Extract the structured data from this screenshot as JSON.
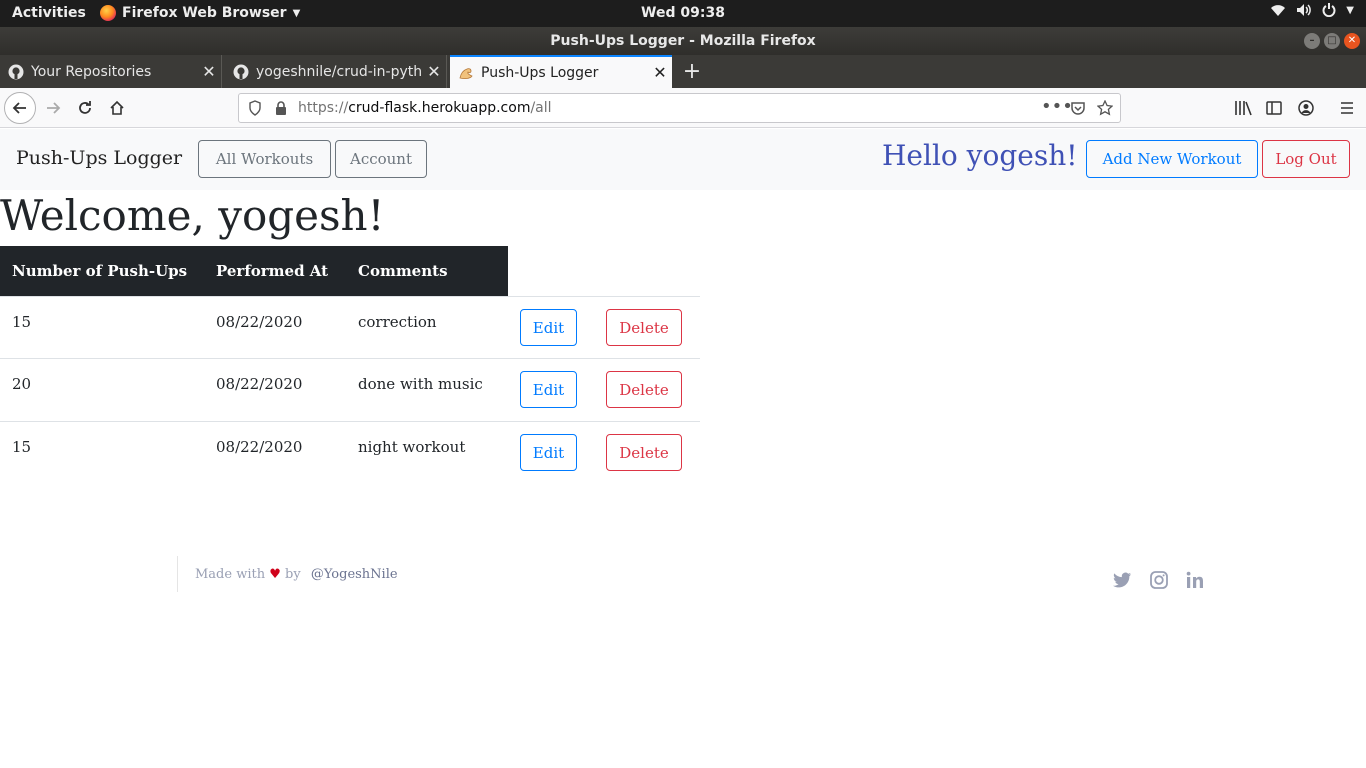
{
  "system": {
    "activities": "Activities",
    "app_menu": "Firefox Web Browser",
    "clock": "Wed 09:38"
  },
  "window": {
    "title": "Push-Ups Logger - Mozilla Firefox"
  },
  "tabs": [
    {
      "label": "Your Repositories",
      "icon": "github-icon"
    },
    {
      "label": "yogeshnile/crud-in-pytho",
      "icon": "github-icon"
    },
    {
      "label": "Push-Ups Logger",
      "icon": "flex-arm-icon",
      "active": true
    }
  ],
  "urlbar": {
    "scheme": "https://",
    "host": "crud-flask.herokuapp.com",
    "path": "/all"
  },
  "site_nav": {
    "brand": "Push-Ups Logger",
    "all_workouts": "All Workouts",
    "account": "Account",
    "greeting": "Hello yogesh!",
    "add_workout": "Add New Workout",
    "logout": "Log Out"
  },
  "page": {
    "heading": "Welcome, yogesh!"
  },
  "table": {
    "headers": [
      "Number of Push-Ups",
      "Performed At",
      "Comments"
    ],
    "rows": [
      {
        "pushups": "15",
        "date": "08/22/2020",
        "comment": "correction"
      },
      {
        "pushups": "20",
        "date": "08/22/2020",
        "comment": "done with music"
      },
      {
        "pushups": "15",
        "date": "08/22/2020",
        "comment": "night workout"
      }
    ],
    "edit_label": "Edit",
    "delete_label": "Delete"
  },
  "footer": {
    "made_with": "Made with",
    "by": "by",
    "handle": "@YogeshNile",
    "social": [
      "twitter-icon",
      "instagram-icon",
      "linkedin-icon"
    ]
  },
  "colors": {
    "primary": "#007bff",
    "danger": "#dc3545",
    "secondary": "#6c757d",
    "greeting": "#3f51b5",
    "table_head": "#212529"
  }
}
